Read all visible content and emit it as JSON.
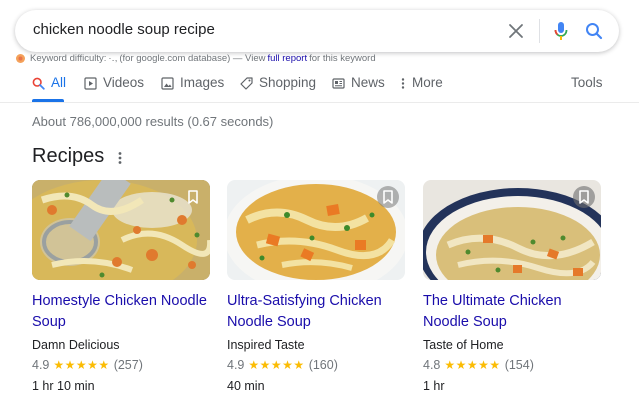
{
  "search": {
    "query": "chicken noodle soup recipe",
    "clear_icon": "close-icon",
    "mic_icon": "microphone-icon",
    "search_icon": "search-icon"
  },
  "keyword_difficulty": {
    "label": "Keyword difficulty:",
    "value": "·․,",
    "database_note": "(for google.com database) — View",
    "link": "full report",
    "suffix": "for this keyword"
  },
  "tabs": [
    {
      "label": "All",
      "icon": "search-icon",
      "active": true
    },
    {
      "label": "Videos",
      "icon": "video-icon"
    },
    {
      "label": "Images",
      "icon": "image-icon"
    },
    {
      "label": "Shopping",
      "icon": "tag-icon"
    },
    {
      "label": "News",
      "icon": "newspaper-icon"
    },
    {
      "label": "More",
      "icon": "more-vert-icon"
    },
    {
      "label": "Tools"
    }
  ],
  "result_stats": "About 786,000,000 results (0.67 seconds)",
  "recipes": {
    "heading": "Recipes",
    "cards": [
      {
        "title": "Homestyle Chicken Noodle Soup",
        "source": "Damn Delicious",
        "rating": "4.9",
        "stars": "★★★★★",
        "reviews": "(257)",
        "time": "1 hr 10 min"
      },
      {
        "title": "Ultra-Satisfying Chicken Noodle Soup",
        "source": "Inspired Taste",
        "rating": "4.9",
        "stars": "★★★★★",
        "reviews": "(160)",
        "time": "40 min"
      },
      {
        "title": "The Ultimate Chicken Noodle Soup",
        "source": "Taste of Home",
        "rating": "4.8",
        "stars": "★★★★★",
        "reviews": "(154)",
        "time": "1 hr"
      }
    ]
  },
  "colors": {
    "accent": "#1a73e8",
    "link": "#1a0dab",
    "star": "#fbbc04"
  }
}
